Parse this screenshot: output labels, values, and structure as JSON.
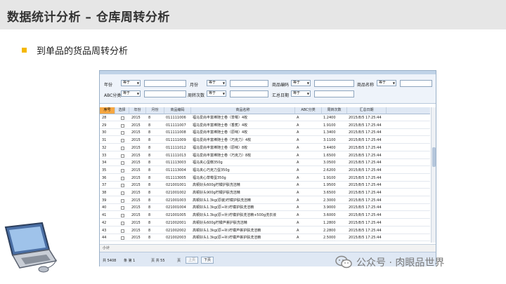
{
  "page": {
    "title": "数据统计分析 – 仓库周转分析",
    "subtitle": "到单品的货品周转分析"
  },
  "filters": {
    "operator": "等于",
    "items": [
      {
        "label": "年份"
      },
      {
        "label": "月份"
      },
      {
        "label": "商品编码"
      },
      {
        "label": "商品名称"
      },
      {
        "label": "ABC分类"
      },
      {
        "label": "周转次数"
      },
      {
        "label": "汇总日期"
      }
    ]
  },
  "grid": {
    "columns": [
      "序号",
      "选择",
      "年份",
      "月份",
      "商品编码",
      "商品名称",
      "ABC分类",
      "周转次数",
      "汇总日期"
    ],
    "rows": [
      {
        "no": "28",
        "year": "2015",
        "month": "8",
        "code": "011111006",
        "name": "福马爱尚丰富棒随士卷（草莓）4枚",
        "abc": "A",
        "turnover": "1.2400",
        "date": "2015/8/5 17:25:44"
      },
      {
        "no": "29",
        "year": "2015",
        "month": "8",
        "code": "011111007",
        "name": "福马爱尚丰富棒随士卷（香蕉）4枚",
        "abc": "A",
        "turnover": "1.9100",
        "date": "2015/8/5 17:25:44"
      },
      {
        "no": "30",
        "year": "2015",
        "month": "8",
        "code": "011111008",
        "name": "福马爱尚丰富棒随士卷（原味）4枚",
        "abc": "A",
        "turnover": "1.3400",
        "date": "2015/8/5 17:25:44"
      },
      {
        "no": "31",
        "year": "2015",
        "month": "8",
        "code": "011111009",
        "name": "福马爱尚丰富棒随士卷（巧克力）4枚",
        "abc": "A",
        "turnover": "3.1100",
        "date": "2015/8/5 17:25:44"
      },
      {
        "no": "32",
        "year": "2015",
        "month": "8",
        "code": "011111012",
        "name": "福马爱尚丰富棒随士卷（原味）8枚",
        "abc": "A",
        "turnover": "3.4400",
        "date": "2015/8/5 17:25:44"
      },
      {
        "no": "33",
        "year": "2015",
        "month": "8",
        "code": "011111013",
        "name": "福马爱尚丰富棒随士卷（巧克力）8枚",
        "abc": "A",
        "turnover": "1.6500",
        "date": "2015/8/5 17:25:44"
      },
      {
        "no": "34",
        "year": "2015",
        "month": "8",
        "code": "011113003",
        "name": "福马夹心蛋糕350g",
        "abc": "A",
        "turnover": "3.0500",
        "date": "2015/8/5 17:25:44"
      },
      {
        "no": "35",
        "year": "2015",
        "month": "8",
        "code": "011113004",
        "name": "福马夹心巧克力蛋350g",
        "abc": "A",
        "turnover": "2.6200",
        "date": "2015/8/5 17:25:44"
      },
      {
        "no": "36",
        "year": "2015",
        "month": "8",
        "code": "011113005",
        "name": "福马夹心草莓蛋350g",
        "abc": "A",
        "turnover": "1.9100",
        "date": "2015/8/5 17:25:44"
      },
      {
        "no": "37",
        "year": "2015",
        "month": "8",
        "code": "021001001",
        "name": "高顿好头600g柠檬护肤洗洁精",
        "abc": "A",
        "turnover": "1.9500",
        "date": "2015/8/5 17:25:44"
      },
      {
        "no": "38",
        "year": "2015",
        "month": "8",
        "code": "021001002",
        "name": "高顿好头900g柠檬护肤洗洁精",
        "abc": "A",
        "turnover": "3.6500",
        "date": "2015/8/5 17:25:44"
      },
      {
        "no": "39",
        "year": "2015",
        "month": "8",
        "code": "021001003",
        "name": "高顿好头1.3kg(原装)柠檬护肤洗洁精",
        "abc": "A",
        "turnover": "2.3000",
        "date": "2015/8/5 17:25:44"
      },
      {
        "no": "40",
        "year": "2015",
        "month": "8",
        "code": "021001004",
        "name": "高顿好头1.3kg(原+补)柠檬护肤洗洁精",
        "abc": "A",
        "turnover": "3.9000",
        "date": "2015/8/5 17:25:44"
      },
      {
        "no": "41",
        "year": "2015",
        "month": "8",
        "code": "021001005",
        "name": "高顿好头1.3kg(原+补)柠檬护肤洗洁精+500g洗衣液",
        "abc": "A",
        "turnover": "3.6000",
        "date": "2015/8/5 17:25:44"
      },
      {
        "no": "42",
        "year": "2015",
        "month": "8",
        "code": "021002001",
        "name": "高顿好头600g柠檬芦荟护肤洗洁精",
        "abc": "A",
        "turnover": "1.2800",
        "date": "2015/8/5 17:25:44"
      },
      {
        "no": "43",
        "year": "2015",
        "month": "8",
        "code": "021002002",
        "name": "高顿好头1.3kg(原+补)柠檬芦荟护肤洗洁精",
        "abc": "A",
        "turnover": "2.2800",
        "date": "2015/8/5 17:25:44"
      },
      {
        "no": "44",
        "year": "2015",
        "month": "8",
        "code": "021002003",
        "name": "高顿好头1.3kg(原+补)柠檬芦荟护肤洗洁精",
        "abc": "A",
        "turnover": "2.5000",
        "date": "2015/8/5 17:25:44"
      }
    ],
    "subtotal_label": "小计"
  },
  "pager": {
    "total_label": "共 5408",
    "record_label": "条 第 1",
    "pages_label": "页 共 55",
    "page_suffix": "页",
    "prev_label": "上页",
    "next_label": "下页"
  },
  "watermark": {
    "text": "公众号 · 肉眼品世界"
  },
  "colors": {
    "accent": "#f5b800",
    "selected_header": "#f5a742",
    "header_bg": "#dfe8f4",
    "title_bar": "#e6e6e6"
  },
  "icons": [
    "checkbox-icon",
    "dropdown-arrow-icon",
    "laptop-icon",
    "wechat-icon"
  ]
}
